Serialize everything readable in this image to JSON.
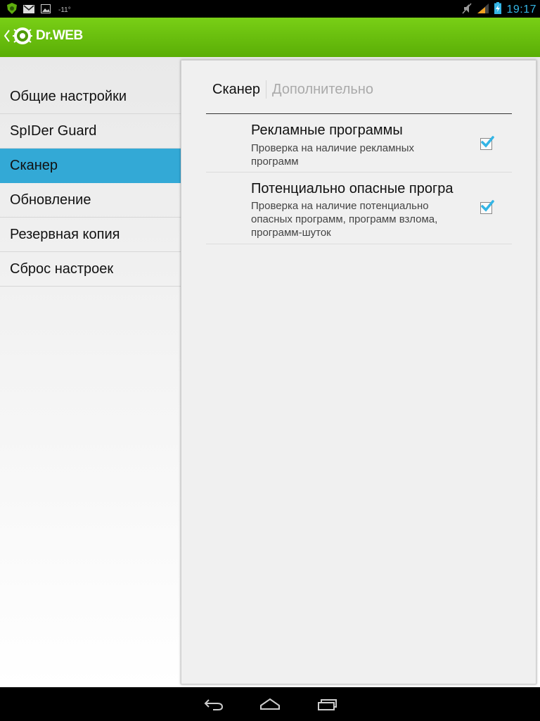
{
  "status_bar": {
    "temperature": "-11°",
    "time": "19:17",
    "icons": [
      "drweb-shield-icon",
      "gmail-icon",
      "gallery-icon",
      "mute-icon",
      "signal-icon",
      "battery-charging-icon"
    ]
  },
  "action_bar": {
    "title": "Dr.WEB",
    "brand_color": "#62b80b"
  },
  "sidebar": {
    "items": [
      {
        "label": "Общие настройки",
        "selected": false
      },
      {
        "label": "SpIDer Guard",
        "selected": false
      },
      {
        "label": "Сканер",
        "selected": true
      },
      {
        "label": "Обновление",
        "selected": false
      },
      {
        "label": "Резервная копия",
        "selected": false
      },
      {
        "label": "Сброс настроек",
        "selected": false
      }
    ],
    "selected_color": "#33a9d6"
  },
  "panel": {
    "tabs": [
      {
        "label": "Сканер",
        "active": true
      },
      {
        "label": "Дополнительно",
        "active": false
      }
    ],
    "preferences": [
      {
        "title": "Рекламные программы",
        "summary": "Проверка на наличие рекламных программ",
        "checked": true
      },
      {
        "title": "Потенциально опасные програ",
        "summary": "Проверка на наличие потенциально опасных программ, программ взлома, программ-шуток",
        "checked": true
      }
    ]
  },
  "nav_bar": {
    "buttons": [
      "back-icon",
      "home-icon",
      "recent-apps-icon"
    ]
  }
}
